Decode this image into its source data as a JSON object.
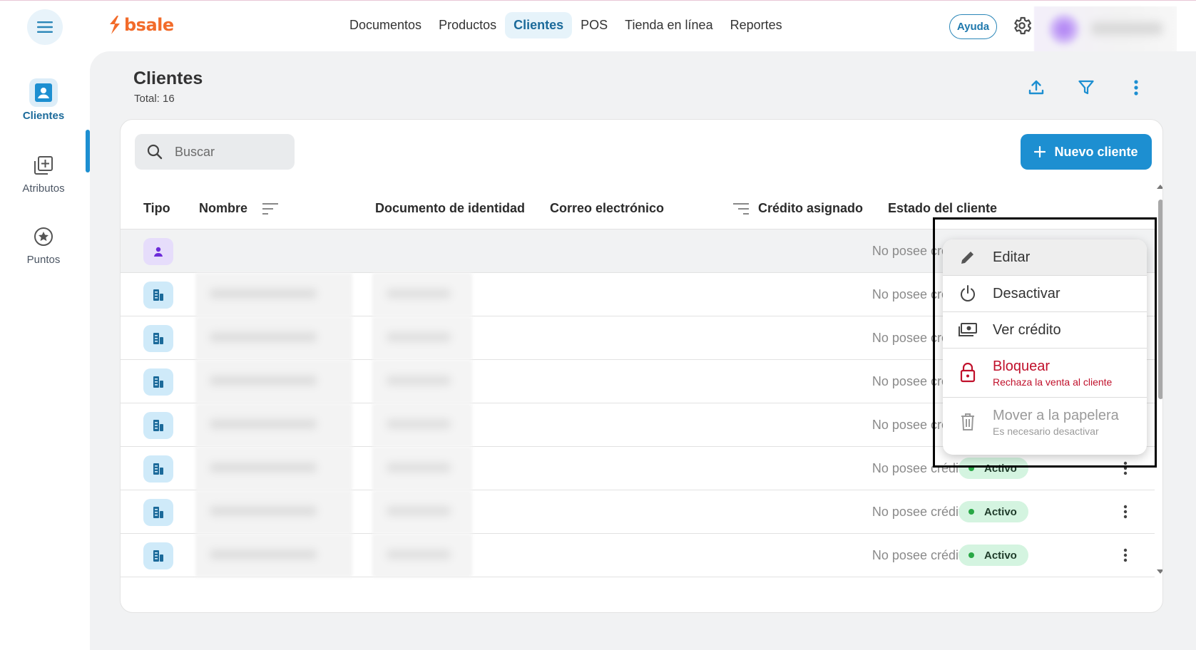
{
  "brand": {
    "name": "bsale",
    "color": "#f26b2a"
  },
  "nav": {
    "items": [
      {
        "label": "Documentos",
        "active": false
      },
      {
        "label": "Productos",
        "active": false
      },
      {
        "label": "Clientes",
        "active": true
      },
      {
        "label": "POS",
        "active": false
      },
      {
        "label": "Tienda en línea",
        "active": false
      },
      {
        "label": "Reportes",
        "active": false
      }
    ],
    "help_label": "Ayuda"
  },
  "sidebar": {
    "items": [
      {
        "label": "Clientes",
        "icon": "contact-card-icon",
        "active": true
      },
      {
        "label": "Atributos",
        "icon": "add-box-icon",
        "active": false
      },
      {
        "label": "Puntos",
        "icon": "star-circle-icon",
        "active": false
      }
    ]
  },
  "page": {
    "title": "Clientes",
    "total": "Total: 16"
  },
  "search": {
    "placeholder": "Buscar"
  },
  "new_button": {
    "label": "Nuevo cliente"
  },
  "table": {
    "headers": {
      "tipo": "Tipo",
      "nombre": "Nombre",
      "documento": "Documento de identidad",
      "correo": "Correo electrónico",
      "credito": "Crédito asignado",
      "estado": "Estado del cliente"
    },
    "rows": [
      {
        "type": "person",
        "credit": "No posee crédito",
        "status": ""
      },
      {
        "type": "company",
        "credit": "No posee crédito",
        "status": ""
      },
      {
        "type": "company",
        "credit": "No posee crédito",
        "status": ""
      },
      {
        "type": "company",
        "credit": "No posee crédito",
        "status": ""
      },
      {
        "type": "company",
        "credit": "No posee crédito",
        "status": ""
      },
      {
        "type": "company",
        "credit": "No posee crédito",
        "status": "Activo"
      },
      {
        "type": "company",
        "credit": "No posee crédito",
        "status": "Activo"
      },
      {
        "type": "company",
        "credit": "No posee crédito",
        "status": "Activo"
      }
    ]
  },
  "context_menu": {
    "items": [
      {
        "label": "Editar",
        "icon": "pencil-icon"
      },
      {
        "label": "Desactivar",
        "icon": "power-icon"
      },
      {
        "label": "Ver crédito",
        "icon": "money-icon"
      },
      {
        "label": "Bloquear",
        "sublabel": "Rechaza la venta al cliente",
        "icon": "lock-icon"
      },
      {
        "label": "Mover a la papelera",
        "sublabel": "Es necesario desactivar",
        "icon": "trash-icon"
      }
    ]
  },
  "colors": {
    "accent": "#1d8fd1",
    "danger": "#c0102b",
    "active_status_bg": "#d4f4e0",
    "active_dot": "#28a745"
  }
}
